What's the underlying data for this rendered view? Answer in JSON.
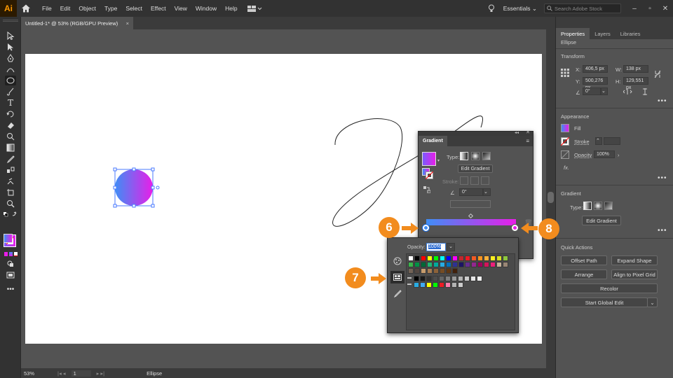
{
  "app": {
    "logo_text": "Ai"
  },
  "menu": [
    "File",
    "Edit",
    "Object",
    "Type",
    "Select",
    "Effect",
    "View",
    "Window",
    "Help"
  ],
  "workspace": {
    "label": "Essentials",
    "search_placeholder": "Search Adobe Stock"
  },
  "document": {
    "tab_title": "Untitled-1* @ 53% (RGB/GPU Preview)",
    "close": "×"
  },
  "status": {
    "zoom": "53%",
    "page": "1",
    "tool_name": "Ellipse"
  },
  "properties": {
    "tabs": [
      "Properties",
      "Layers",
      "Libraries"
    ],
    "object_type": "Ellipse",
    "transform": {
      "header": "Transform",
      "x_label": "X:",
      "x": "406,5 px",
      "y_label": "Y:",
      "y": "500,276 px",
      "w_label": "W:",
      "w": "138 px",
      "h_label": "H:",
      "h": "129,551 px",
      "angle": "0°"
    },
    "appearance": {
      "header": "Appearance",
      "fill": "Fill",
      "stroke": "Stroke",
      "opacity_label": "Opacity",
      "opacity": "100%",
      "fx": "fx."
    },
    "gradient": {
      "header": "Gradient",
      "type_label": "Type:",
      "edit_button": "Edit Gradient"
    },
    "quick_actions": {
      "header": "Quick Actions",
      "offset_path": "Offset Path",
      "expand_shape": "Expand Shape",
      "arrange": "Arrange",
      "align_grid": "Align to Pixel Grid",
      "recolor": "Recolor",
      "global_edit": "Start Global Edit"
    }
  },
  "gradient_panel": {
    "title": "Gradient",
    "type_label": "Type:",
    "edit_button": "Edit Gradient",
    "stroke_label": "Stroke:",
    "angle": "0°"
  },
  "swatch_popup": {
    "opacity_label": "Opacity:",
    "opacity_value": "100%"
  },
  "callouts": [
    "6",
    "7",
    "8"
  ],
  "colors": {
    "gradient_start": "#3f8ef5",
    "gradient_end": "#e81ee8",
    "accent": "#f28c1e"
  },
  "swatches": {
    "row1": [
      "#ffffff",
      "#000000",
      "#ff0000",
      "#ffff00",
      "#00ff00",
      "#00ffff",
      "#0000ff",
      "#ff00ff",
      "#c1272d",
      "#ed1c24",
      "#f15a24",
      "#f7931e",
      "#fbb03b",
      "#fcee21",
      "#d9e021",
      "#8cc63f"
    ],
    "row2": [
      "#39b54a",
      "#009245",
      "#006837",
      "#22b573",
      "#00a99d",
      "#29abe2",
      "#0071bc",
      "#2e3192",
      "#1b1464",
      "#662d91",
      "#93278f",
      "#9e005d",
      "#d4145a",
      "#ed1e79",
      "#c7b299",
      "#998675"
    ],
    "row3": [
      "#736357",
      "#534741",
      "#c69c6d",
      "#a67c52",
      "#8c6239",
      "#754c24",
      "#603813",
      "#42210b"
    ],
    "row4": [
      "#000000",
      "#1a1a1a",
      "#333333",
      "#4d4d4d",
      "#666666",
      "#808080",
      "#999999",
      "#b3b3b3",
      "#cccccc",
      "#e6e6e6",
      "#f2f2f2"
    ],
    "row5": [
      "#29abe2",
      "#3fa9f5",
      "#ffff00",
      "#00ff00",
      "#ed1c24",
      "#ff7bac",
      "#b3b3b3",
      "#cccccc"
    ]
  }
}
